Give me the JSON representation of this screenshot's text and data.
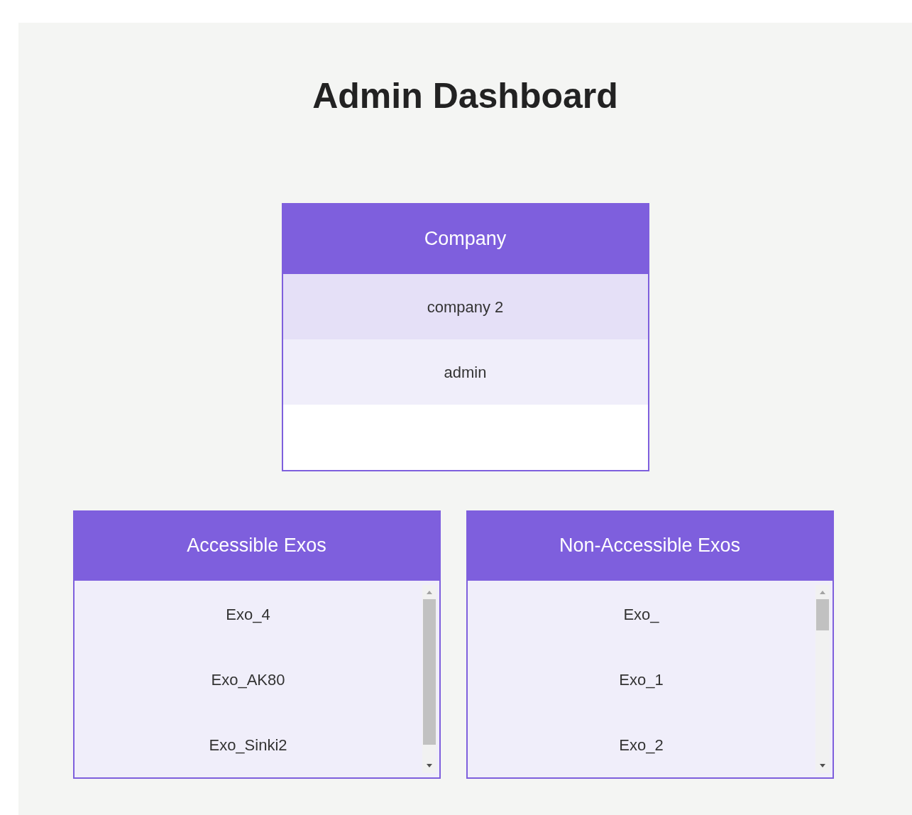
{
  "title": "Admin Dashboard",
  "company": {
    "heading": "Company",
    "rows": [
      "company 2",
      "admin"
    ]
  },
  "lists": [
    {
      "heading": "Accessible Exos",
      "items": [
        "Exo_4",
        "Exo_AK80",
        "Exo_Sinki2"
      ]
    },
    {
      "heading": "Non-Accessible Exos",
      "items": [
        "Exo_",
        "Exo_1",
        "Exo_2"
      ]
    }
  ]
}
